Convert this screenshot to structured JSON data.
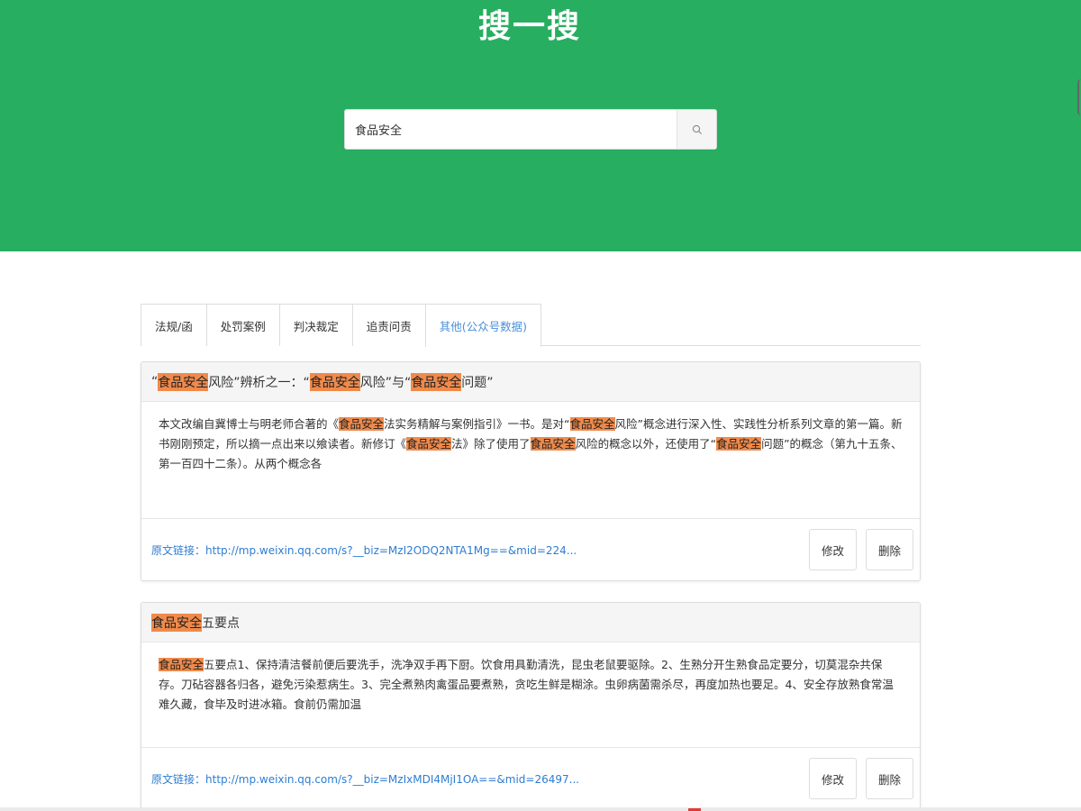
{
  "header": {
    "title": "搜一搜",
    "bg_color": "#27ae60"
  },
  "search": {
    "value": "食品安全",
    "button_icon": "search-icon"
  },
  "tabs": [
    {
      "label": "法规/函",
      "active": false
    },
    {
      "label": "处罚案例",
      "active": false
    },
    {
      "label": "判决裁定",
      "active": false
    },
    {
      "label": "追责问责",
      "active": false
    },
    {
      "label": "其他(公众号数据)",
      "active": true
    }
  ],
  "highlight_color": "#f08a4b",
  "results": [
    {
      "title_segments": [
        {
          "text": "“",
          "hl": false
        },
        {
          "text": "食品安全",
          "hl": true
        },
        {
          "text": "风险”辨析之一：“",
          "hl": false
        },
        {
          "text": "食品安全",
          "hl": true
        },
        {
          "text": "风险”与“",
          "hl": false
        },
        {
          "text": "食品安全",
          "hl": true
        },
        {
          "text": "问题”",
          "hl": false
        }
      ],
      "body_segments": [
        {
          "text": "本文改编自冀博士与明老师合著的《",
          "hl": false
        },
        {
          "text": "食品安全",
          "hl": true
        },
        {
          "text": "法实务精解与案例指引》一书。是对“",
          "hl": false
        },
        {
          "text": "食品安全",
          "hl": true
        },
        {
          "text": "风险”概念进行深入性、实践性分析系列文章的第一篇。新书刚刚预定，所以摘一点出来以飨读者。新修订《",
          "hl": false
        },
        {
          "text": "食品安全",
          "hl": true
        },
        {
          "text": "法》除了使用了",
          "hl": false
        },
        {
          "text": "食品安全",
          "hl": true
        },
        {
          "text": "风险的概念以外，还使用了“",
          "hl": false
        },
        {
          "text": "食品安全",
          "hl": true
        },
        {
          "text": "问题”的概念（第九十五条、第一百四十二条）。从两个概念各",
          "hl": false
        }
      ],
      "link_label": "原文链接：",
      "link_url": "http://mp.weixin.qq.com/s?__biz=MzI2ODQ2NTA1Mg==&mid=224...",
      "edit_label": "修改",
      "delete_label": "删除"
    },
    {
      "title_segments": [
        {
          "text": "食品安全",
          "hl": true
        },
        {
          "text": "五要点",
          "hl": false
        }
      ],
      "body_segments": [
        {
          "text": "食品安全",
          "hl": true
        },
        {
          "text": "五要点1、保持清洁餐前便后要洗手，洗净双手再下厨。饮食用具勤清洗，昆虫老鼠要驱除。2、生熟分开生熟食品定要分，切莫混杂共保存。刀砧容器各归各，避免污染惹病生。3、完全煮熟肉禽蛋品要煮熟，贪吃生鲜是糊涂。虫卵病菌需杀尽，再度加热也要足。4、安全存放熟食常温难久藏，食毕及时进冰箱。食前仍需加温",
          "hl": false
        }
      ],
      "link_label": "原文链接：",
      "link_url": "http://mp.weixin.qq.com/s?__biz=MzIxMDI4MjI1OA==&mid=26497...",
      "edit_label": "修改",
      "delete_label": "删除"
    }
  ]
}
